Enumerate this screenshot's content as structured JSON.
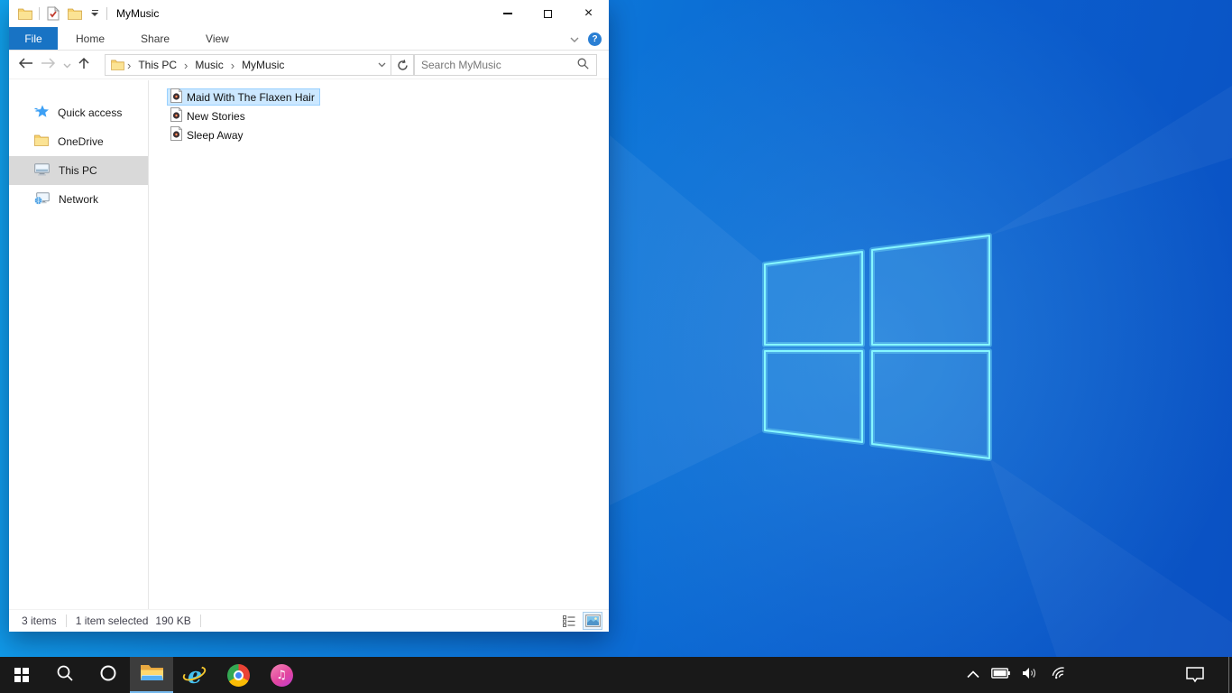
{
  "window": {
    "title": "MyMusic",
    "tabs": [
      {
        "label": "File",
        "active": true
      },
      {
        "label": "Home",
        "active": false
      },
      {
        "label": "Share",
        "active": false
      },
      {
        "label": "View",
        "active": false
      }
    ],
    "breadcrumb": [
      "This PC",
      "Music",
      "MyMusic"
    ],
    "search": {
      "placeholder": "Search MyMusic"
    },
    "sidebar": [
      {
        "label": "Quick access",
        "icon": "star-icon",
        "selected": false
      },
      {
        "label": "OneDrive",
        "icon": "folder-icon",
        "selected": false
      },
      {
        "label": "This PC",
        "icon": "monitor-icon",
        "selected": true
      },
      {
        "label": "Network",
        "icon": "network-icon",
        "selected": false
      }
    ],
    "files": [
      {
        "name": "Maid With The Flaxen Hair",
        "icon": "music-file-icon",
        "selected": true
      },
      {
        "name": "New Stories",
        "icon": "music-file-icon",
        "selected": false
      },
      {
        "name": "Sleep Away",
        "icon": "music-file-icon",
        "selected": false
      }
    ],
    "status": {
      "count": "3 items",
      "selected": "1 item selected",
      "size": "190 KB"
    }
  },
  "taskbar": {
    "buttons": [
      "start",
      "search",
      "cortana",
      "file-explorer",
      "internet-explorer",
      "chrome",
      "itunes"
    ],
    "active_button": "file-explorer",
    "tray": [
      "chevron-up",
      "battery",
      "volume",
      "wifi",
      "action-center"
    ]
  },
  "colors": {
    "file_tab_blue": "#1873c4",
    "selection_fill": "#cce8ff",
    "selection_border": "#99d1ff",
    "sidebar_selected": "#d9d9d9",
    "taskbar": "#191919",
    "explorer_underline": "#76b9ed",
    "wallpaper_light": "#11a3ec",
    "wallpaper_dark": "#0a50c2",
    "logo_edge": "#86f7ff"
  }
}
